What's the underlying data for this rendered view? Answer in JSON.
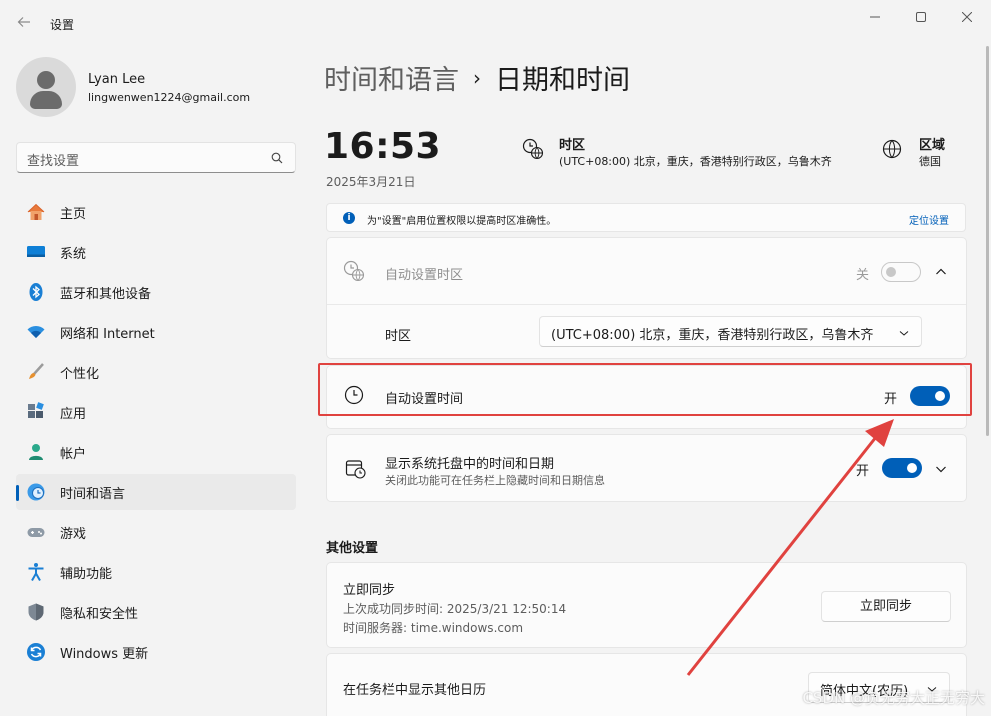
{
  "window": {
    "title": "设置"
  },
  "user": {
    "name": "Lyan Lee",
    "email": "lingwenwen1224@gmail.com"
  },
  "search": {
    "placeholder": "查找设置"
  },
  "nav": [
    {
      "label": "主页",
      "icon": "home-icon"
    },
    {
      "label": "系统",
      "icon": "system-icon"
    },
    {
      "label": "蓝牙和其他设备",
      "icon": "bluetooth-icon"
    },
    {
      "label": "网络和 Internet",
      "icon": "wifi-icon"
    },
    {
      "label": "个性化",
      "icon": "brush-icon"
    },
    {
      "label": "应用",
      "icon": "apps-icon"
    },
    {
      "label": "帐户",
      "icon": "account-icon"
    },
    {
      "label": "时间和语言",
      "icon": "time-language-icon",
      "active": true
    },
    {
      "label": "游戏",
      "icon": "gamepad-icon"
    },
    {
      "label": "辅助功能",
      "icon": "accessibility-icon"
    },
    {
      "label": "隐私和安全性",
      "icon": "shield-icon"
    },
    {
      "label": "Windows 更新",
      "icon": "update-icon"
    }
  ],
  "breadcrumb": {
    "parent": "时间和语言",
    "separator": "›",
    "current": "日期和时间"
  },
  "summary": {
    "time": "16:53",
    "date": "2025年3月21日",
    "timezone_title": "时区",
    "timezone_value": "(UTC+08:00) 北京，重庆，香港特别行政区，乌鲁木齐",
    "region_title": "区域",
    "region_value": "德国"
  },
  "info": {
    "text": "为\"设置\"启用位置权限以提高时区准确性。",
    "link": "定位设置"
  },
  "settings": {
    "auto_timezone": {
      "label": "自动设置时区",
      "state": "关",
      "on": false
    },
    "timezone": {
      "label": "时区",
      "value": "(UTC+08:00) 北京，重庆，香港特别行政区，乌鲁木齐"
    },
    "auto_time": {
      "label": "自动设置时间",
      "state": "开",
      "on": true
    },
    "tray": {
      "label": "显示系统托盘中的时间和日期",
      "sub": "关闭此功能可在任务栏上隐藏时间和日期信息",
      "state": "开",
      "on": true
    }
  },
  "other": {
    "title": "其他设置",
    "sync": {
      "title": "立即同步",
      "last_sync": "上次成功同步时间: 2025/3/21 12:50:14",
      "server": "时间服务器: time.windows.com",
      "button": "立即同步"
    },
    "calendar": {
      "label": "在任务栏中显示其他日历",
      "value": "简体中文(农历)"
    }
  },
  "watermark": "CSDN @负无穷大正无穷大",
  "colors": {
    "accent": "#005fb8",
    "highlight": "#e0423f"
  }
}
